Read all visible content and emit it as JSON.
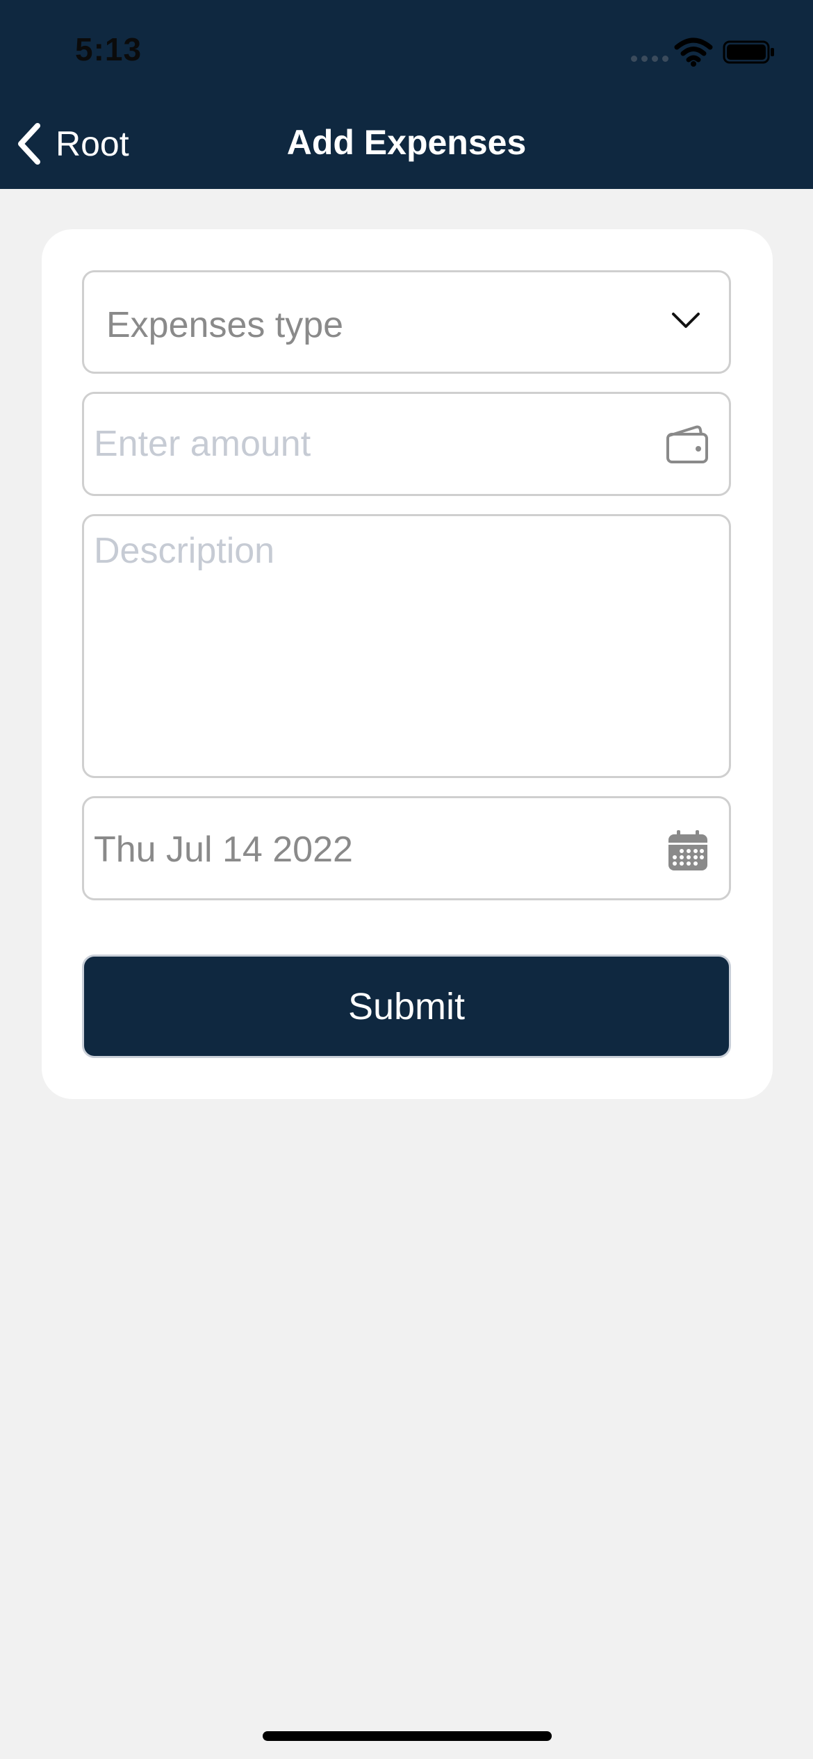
{
  "status_bar": {
    "time": "5:13",
    "icons": [
      "cellular-signal-icon",
      "wifi-icon",
      "battery-icon"
    ]
  },
  "nav": {
    "back_label": "Root",
    "title": "Add Expenses"
  },
  "form": {
    "expense_type": {
      "placeholder": "Expenses type",
      "value": ""
    },
    "amount": {
      "placeholder": "Enter amount",
      "value": "",
      "icon": "wallet-icon"
    },
    "description": {
      "placeholder": "Description",
      "value": ""
    },
    "date": {
      "value": "Thu Jul 14 2022",
      "icon": "calendar-icon"
    },
    "submit_label": "Submit"
  },
  "colors": {
    "header_bg": "#0f2840",
    "page_bg": "#f1f1f1",
    "card_bg": "#ffffff",
    "submit_bg": "#0f2840",
    "placeholder_text": "#c6cbd4",
    "field_text": "#8a8a8a"
  }
}
